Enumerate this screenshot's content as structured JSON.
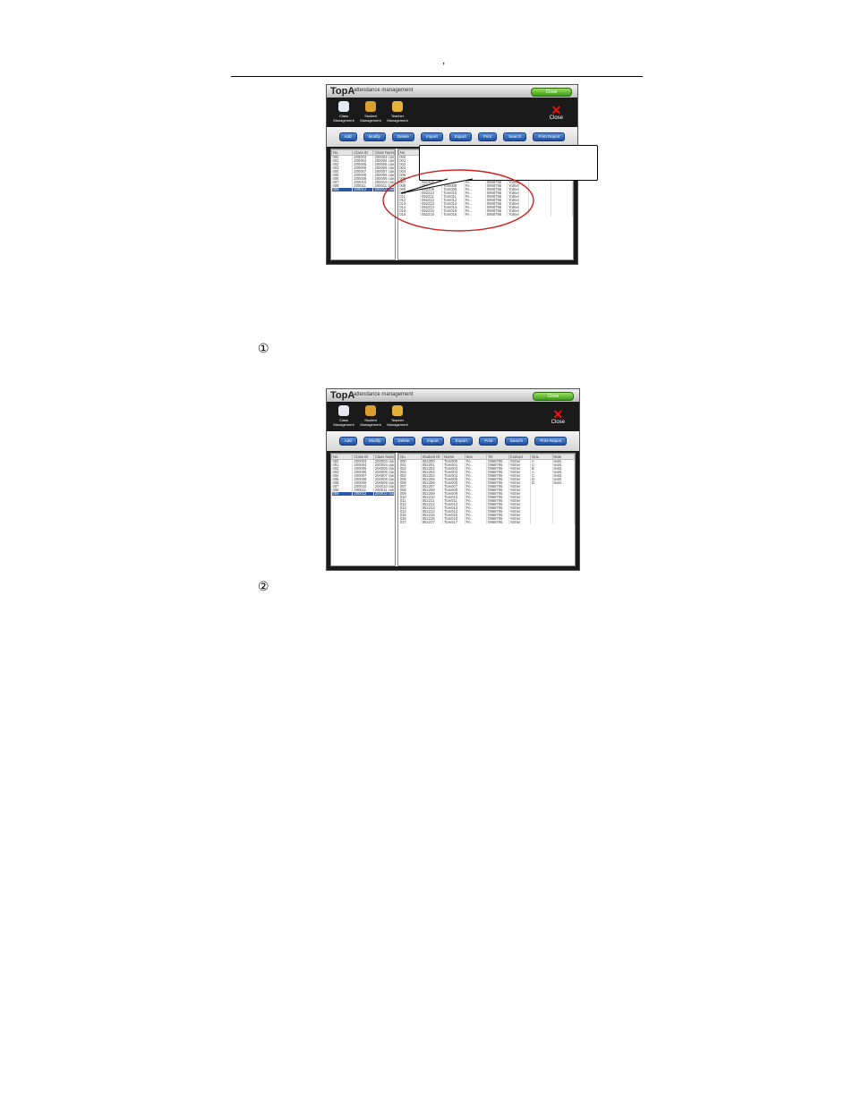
{
  "header": {
    "mark": ","
  },
  "markers": {
    "first": "①",
    "second": "②"
  },
  "app": {
    "logo": "TopA",
    "subtitle": "attendance management",
    "top_button": "Close",
    "nav": [
      {
        "label": "Class Management",
        "icon": "class-icon",
        "color": "#e8e8f0"
      },
      {
        "label": "Student Management",
        "icon": "student-icon",
        "color": "#d9a030"
      },
      {
        "label": "Teacher Management",
        "icon": "teacher-icon",
        "color": "#e3b23a"
      }
    ],
    "close_label": "Close",
    "toolbar": [
      "Add",
      "Modify",
      "Delete",
      "Import",
      "Export",
      "Print",
      "Search",
      "Print Report"
    ]
  },
  "screen1": {
    "class_table": {
      "headers": [
        "No.",
        "Class ID",
        "Class Name"
      ],
      "rows": [
        [
          "000",
          "200003",
          "200003 class"
        ],
        [
          "001",
          "200004",
          "200004 class"
        ],
        [
          "002",
          "200005",
          "200005 class"
        ],
        [
          "003",
          "200006",
          "200006 class"
        ],
        [
          "004",
          "200007",
          "200007 class"
        ],
        [
          "005",
          "200008",
          "200008 class"
        ],
        [
          "006",
          "200009",
          "200009 class"
        ],
        [
          "007",
          "200010",
          "200010 class"
        ],
        [
          "008",
          "200011",
          "200011 class"
        ],
        [
          "009",
          "200012",
          "200012 class"
        ]
      ],
      "selected": 9
    },
    "student_table": {
      "headers": [
        "No.",
        "Student ID",
        "Name",
        "Sex",
        "Tel",
        "Contact",
        "Grade",
        "Note"
      ],
      "rows": [
        [
          "000",
          "052200",
          "Tom000",
          "Fe..",
          "0968795",
          "Yother",
          "A",
          "tests"
        ],
        [
          "001",
          "052201",
          "Tom001",
          "Fe..",
          "0968795",
          "Yother",
          "C",
          "tests"
        ],
        [
          "002",
          "052202",
          "Tom002",
          "Fe..",
          "0968795",
          "Yother",
          "B",
          "tests"
        ],
        [
          "003",
          "052203",
          "Tom003",
          "Fe..",
          "0968795",
          "Yother",
          "A",
          "tests"
        ],
        [
          "004",
          "052204",
          "Tom004",
          "Fe..",
          "0968795",
          "Yother",
          "C",
          "tests"
        ],
        [
          "005",
          "052205",
          "Tom005",
          "Fe..",
          "0968795",
          "Yother",
          "D",
          "tests"
        ],
        [
          "006",
          "052206",
          "Tom006",
          "Fe..",
          "0968795",
          "Yother",
          "",
          ""
        ],
        [
          "007",
          "052207",
          "Tom007",
          "Fe..",
          "0968795",
          "Yother",
          "",
          ""
        ],
        [
          "008",
          "052208",
          "Tom008",
          "Fe..",
          "0968795",
          "Yother",
          "",
          ""
        ],
        [
          "009",
          "052209",
          "Tom009",
          "Fe..",
          "0968795",
          "Yother",
          "",
          ""
        ],
        [
          "010",
          "052210",
          "Tom010",
          "Fe..",
          "0968795",
          "Yother",
          "",
          ""
        ],
        [
          "011",
          "052211",
          "Tom011",
          "Fe..",
          "0968795",
          "Yother",
          "",
          ""
        ],
        [
          "012",
          "052212",
          "Tom012",
          "Fe..",
          "0968795",
          "Yother",
          "",
          ""
        ],
        [
          "013",
          "052213",
          "Tom013",
          "Fe..",
          "0968795",
          "Yother",
          "",
          ""
        ],
        [
          "014",
          "052214",
          "Tom014",
          "Fe..",
          "0968795",
          "Yother",
          "",
          ""
        ],
        [
          "015",
          "052215",
          "Tom015",
          "Fe..",
          "0968795",
          "Yother",
          "",
          ""
        ],
        [
          "016",
          "052216",
          "Tom016",
          "Fe..",
          "0968795",
          "Yother",
          "",
          ""
        ]
      ]
    }
  },
  "screen2": {
    "class_table": {
      "headers": [
        "No.",
        "Class ID",
        "Class Name"
      ],
      "rows": [
        [
          "000",
          "200003",
          "200003 class"
        ],
        [
          "001",
          "200004",
          "200004 class"
        ],
        [
          "002",
          "200005",
          "200005 class"
        ],
        [
          "003",
          "200006",
          "200006 class"
        ],
        [
          "004",
          "200007",
          "200007 class"
        ],
        [
          "005",
          "200008",
          "200008 class"
        ],
        [
          "006",
          "200009",
          "200009 class"
        ],
        [
          "007",
          "200010",
          "200010 class"
        ],
        [
          "008",
          "200011",
          "200011 class"
        ],
        [
          "009",
          "200012",
          "200012 class"
        ]
      ],
      "selected": 9
    },
    "student_table": {
      "headers": [
        "No.",
        "Student ID",
        "Name",
        "Sex",
        "Tel",
        "Contact",
        "Gra..",
        "Note"
      ],
      "rows": [
        [
          "000",
          "052200",
          "Tom000",
          "Fe..",
          "0968795",
          "Yother",
          "A",
          "tests"
        ],
        [
          "001",
          "052201",
          "Tom001",
          "Fe..",
          "0968795",
          "Yother",
          "C",
          "tests"
        ],
        [
          "002",
          "052202",
          "Tom002",
          "Fe..",
          "0968795",
          "Yother",
          "B",
          "tests"
        ],
        [
          "003",
          "052203",
          "Tom003",
          "Fe..",
          "0968795",
          "Yother",
          "A",
          "tests"
        ],
        [
          "004",
          "052204",
          "Tom004",
          "Fe..",
          "0968795",
          "Yother",
          "C",
          "tests"
        ],
        [
          "005",
          "052205",
          "Tom005",
          "Fe..",
          "0968795",
          "Yother",
          "D",
          "tests"
        ],
        [
          "006",
          "052206",
          "Tom006",
          "Fe..",
          "0968795",
          "Yother",
          "D",
          "tests"
        ],
        [
          "007",
          "052207",
          "Tom007",
          "Fe..",
          "0968795",
          "Yother",
          "",
          ""
        ],
        [
          "008",
          "052208",
          "Tom008",
          "Fe..",
          "0968795",
          "Yother",
          "",
          ""
        ],
        [
          "009",
          "052209",
          "Tom009",
          "Fe..",
          "0968795",
          "Yother",
          "",
          ""
        ],
        [
          "010",
          "052210",
          "Tom010",
          "Fe..",
          "0968795",
          "Yother",
          "",
          ""
        ],
        [
          "011",
          "052211",
          "Tom011",
          "Fe..",
          "0968795",
          "Yother",
          "",
          ""
        ],
        [
          "012",
          "052212",
          "Tom012",
          "Fe..",
          "0968795",
          "Yother",
          "",
          ""
        ],
        [
          "013",
          "052213",
          "Tom013",
          "Fe..",
          "0968795",
          "Yother",
          "",
          ""
        ],
        [
          "014",
          "052214",
          "Tom014",
          "Fe..",
          "0968795",
          "Yother",
          "",
          ""
        ],
        [
          "015",
          "052215",
          "Tom015",
          "Fe..",
          "0968795",
          "Yother",
          "",
          ""
        ],
        [
          "016",
          "052216",
          "Tom016",
          "Fe..",
          "0968795",
          "Yother",
          "",
          ""
        ],
        [
          "017",
          "052217",
          "Tom017",
          "Fe..",
          "0968795",
          "Yother",
          "",
          ""
        ]
      ]
    }
  },
  "colors": {
    "selection": "#2a57a6",
    "annotation": "#d02020",
    "toolbar_button": "#2f63b4"
  }
}
